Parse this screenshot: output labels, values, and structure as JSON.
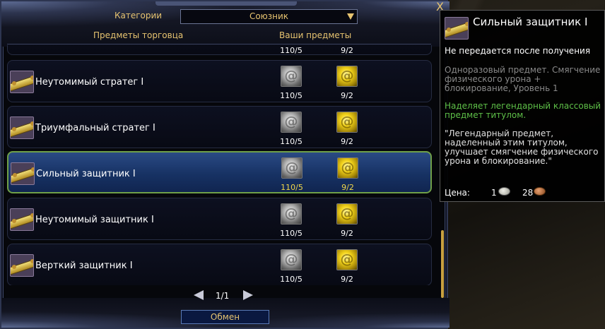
{
  "window": {
    "close_glyph": "X",
    "category_label": "Категории",
    "category_value": "Союзник",
    "header_vendor": "Предметы торговца",
    "header_yours": "Ваши предметы"
  },
  "partial_row": {
    "silver_count": "110/5",
    "gold_count": "9/2"
  },
  "items": [
    {
      "name": "Неутомимый стратег I",
      "silver_count": "110/5",
      "gold_count": "9/2",
      "selected": false
    },
    {
      "name": "Триумфальный стратег I",
      "silver_count": "110/5",
      "gold_count": "9/2",
      "selected": false
    },
    {
      "name": "Сильный защитник I",
      "silver_count": "110/5",
      "gold_count": "9/2",
      "selected": true
    },
    {
      "name": "Неутомимый защитник I",
      "silver_count": "110/5",
      "gold_count": "9/2",
      "selected": false
    },
    {
      "name": "Верткий защитник I",
      "silver_count": "110/5",
      "gold_count": "9/2",
      "selected": false
    }
  ],
  "pager": {
    "text": "1/1"
  },
  "exchange_label": "Обмен",
  "tooltip": {
    "title": "Сильный защитник I",
    "binding": "Не передается после получения",
    "description": "Одноразовый предмет. Смягчение физического урона + блокирование, Уровень 1",
    "effect": "Наделяет легендарный классовый предмет титулом.",
    "quote": "\"Легендарный предмет, наделенный этим титулом, улучшает смягчение физического урона и блокирование.\"",
    "price_label": "Цена:",
    "price_silver": "1",
    "price_copper": "28"
  },
  "colors": {
    "accent_gold": "#e6c370",
    "selected_border": "#6fa048",
    "effect_green": "#5ec048"
  }
}
